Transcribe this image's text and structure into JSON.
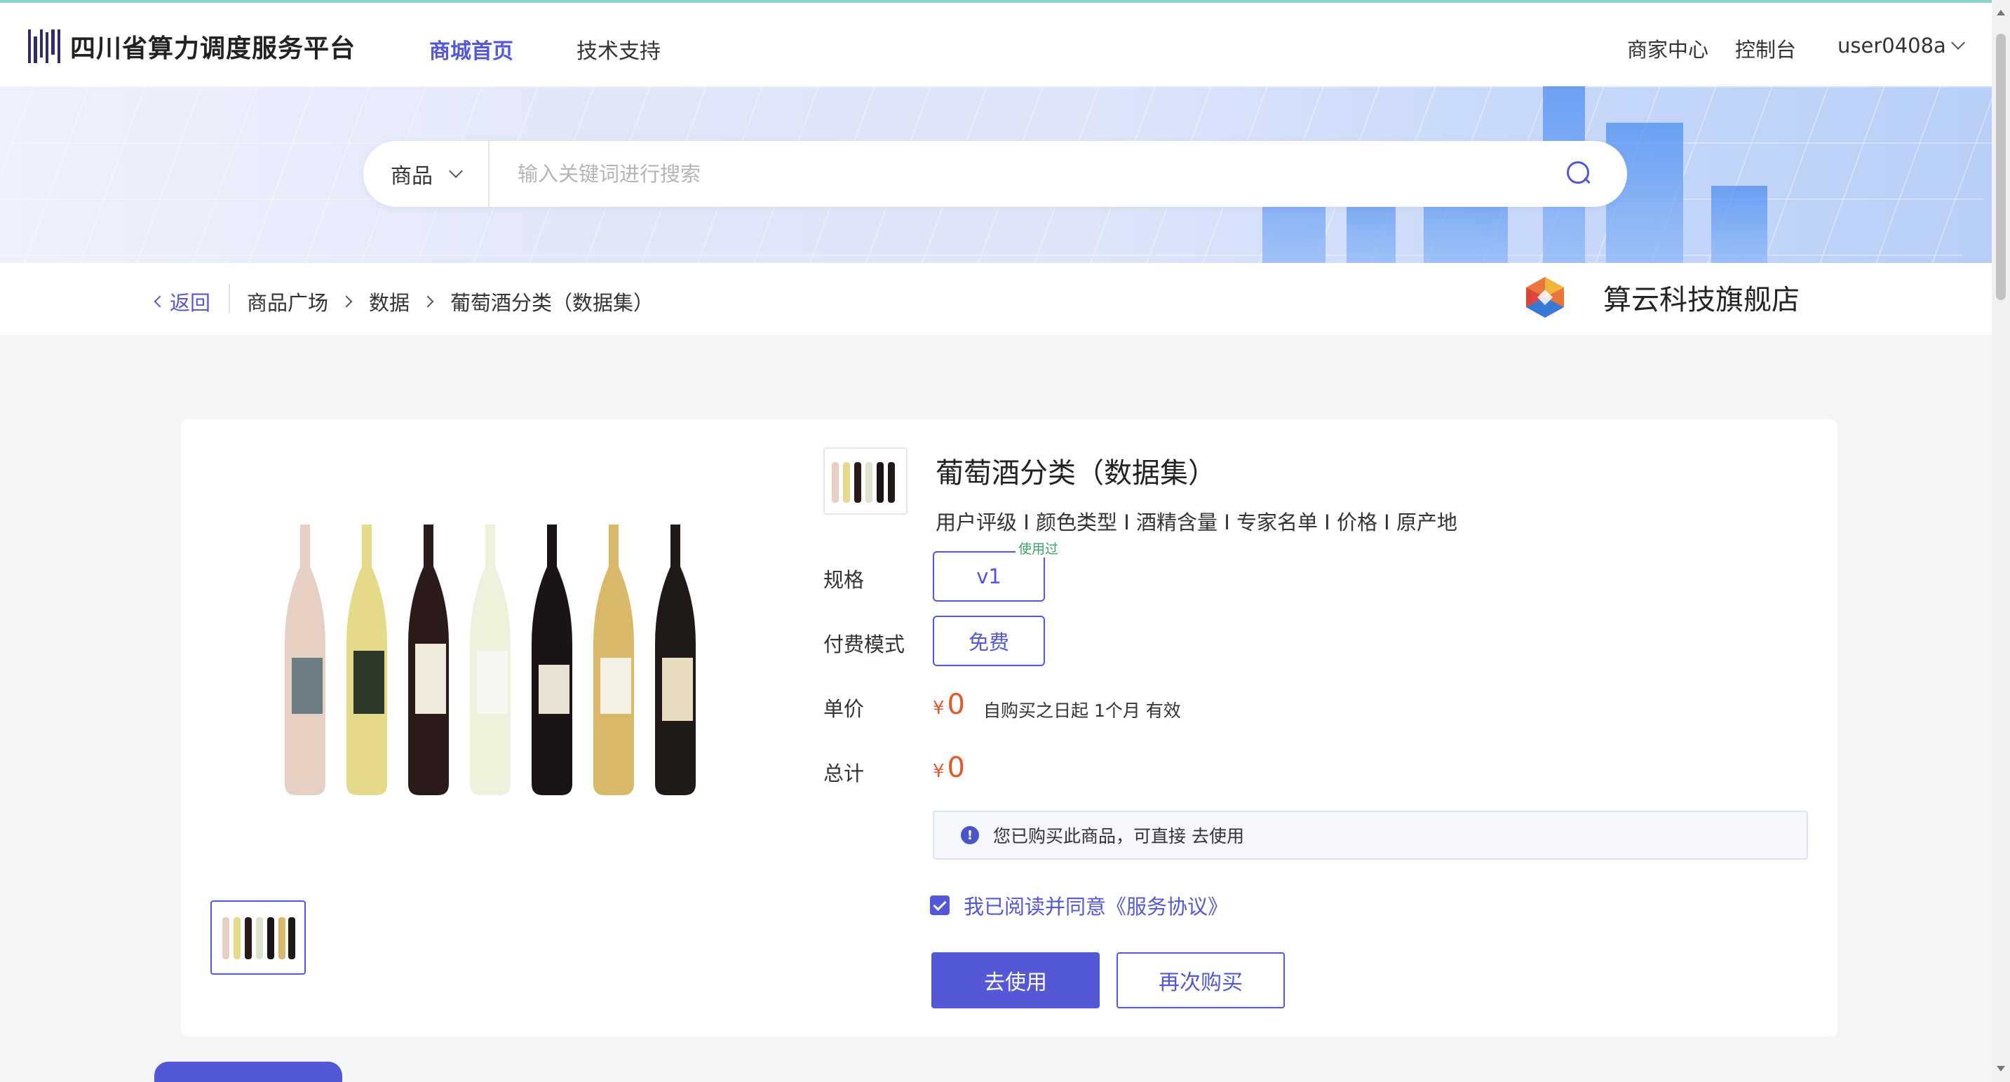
{
  "header": {
    "logo_text": "四川省算力调度服务平台",
    "nav": [
      {
        "label": "商城首页",
        "active": true
      },
      {
        "label": "技术支持",
        "active": false
      }
    ],
    "merchant_center": "商家中心",
    "console": "控制台",
    "username": "user0408a"
  },
  "search": {
    "category": "商品",
    "placeholder": "输入关键词进行搜索"
  },
  "breadcrumb": {
    "back": "返回",
    "items": [
      "商品广场",
      "数据",
      "葡萄酒分类（数据集）"
    ]
  },
  "shop": {
    "name": "算云科技旗舰店"
  },
  "product": {
    "title": "葡萄酒分类（数据集）",
    "tags": "用户评级 I 颜色类型 I 酒精含量 I 专家名单 I 价格 I 原产地",
    "spec_label": "规格",
    "spec_value": "v1",
    "used_tag": "使用过",
    "pay_label": "付费模式",
    "pay_value": "免费",
    "unit_price_label": "单价",
    "currency": "¥",
    "unit_price": "0",
    "validity": "自购买之日起 1个月 有效",
    "total_label": "总计",
    "total": "0",
    "notice": "您已购买此商品，可直接 去使用",
    "agree_text": "我已阅读并同意《服务协议》",
    "use_button": "去使用",
    "rebuy_button": "再次购买"
  },
  "colors": {
    "accent": "#5457d6",
    "price": "#e2592b",
    "used_tag": "#3aa56a"
  }
}
